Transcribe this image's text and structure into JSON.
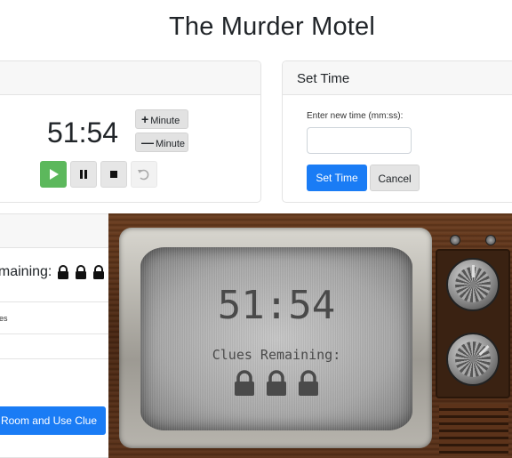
{
  "page": {
    "title": "The Murder Motel"
  },
  "timer_card": {
    "time": "51:54",
    "plus_minute_label": "Minute",
    "minus_minute_label": "Minute",
    "plus_sign": "+",
    "minus_sign": "—"
  },
  "set_time_card": {
    "header": "Set Time",
    "field_label": "Enter new time (mm:ss):",
    "input_value": "",
    "set_button": "Set Time",
    "cancel_button": "Cancel"
  },
  "clues_card": {
    "remaining_label": "emaining:",
    "sub_text": "es",
    "use_clue_button": "Room and Use Clue"
  },
  "tv": {
    "time": "51:54",
    "clues_label": "Clues Remaining:",
    "locks": 3
  },
  "colors": {
    "primary": "#1a7cf5",
    "play": "#5cb85c",
    "wood": "#4e2c17"
  }
}
